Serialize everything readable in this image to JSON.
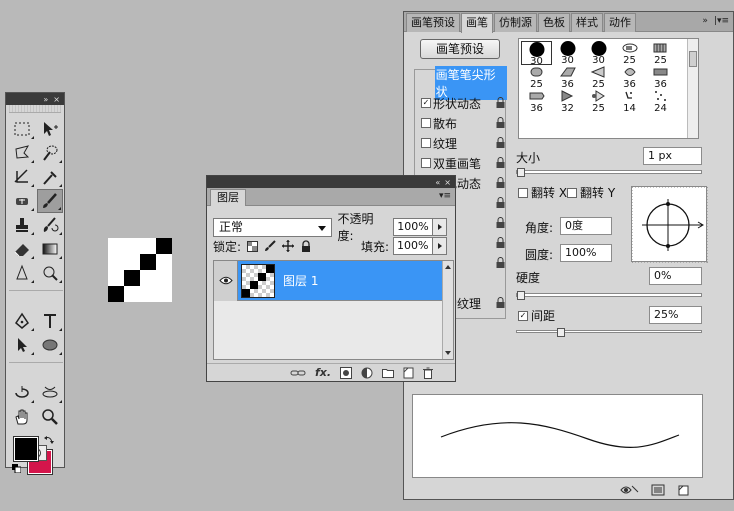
{
  "tools_panel": {
    "collapse_glyph": "»",
    "close_glyph": "×",
    "tools": [
      {
        "name": "marquee-tool-icon",
        "selected": false
      },
      {
        "name": "move-tool-icon",
        "selected": false
      },
      {
        "name": "lasso-tool-icon",
        "selected": false
      },
      {
        "name": "quick-selection-tool-icon",
        "selected": false
      },
      {
        "name": "crop-tool-icon",
        "selected": false
      },
      {
        "name": "eyedropper-tool-icon",
        "selected": false
      },
      {
        "name": "healing-brush-tool-icon",
        "selected": false
      },
      {
        "name": "brush-tool-icon",
        "selected": true
      },
      {
        "name": "clone-stamp-tool-icon",
        "selected": false
      },
      {
        "name": "history-brush-tool-icon",
        "selected": false
      },
      {
        "name": "eraser-tool-icon",
        "selected": false
      },
      {
        "name": "gradient-tool-icon",
        "selected": false
      },
      {
        "name": "blur-tool-icon",
        "selected": false
      },
      {
        "name": "dodge-tool-icon",
        "selected": false
      },
      {
        "name": "pen-tool-icon",
        "selected": false
      },
      {
        "name": "type-tool-icon",
        "selected": false
      },
      {
        "name": "path-selection-tool-icon",
        "selected": false
      },
      {
        "name": "ellipse-tool-icon",
        "selected": false
      },
      {
        "name": "3d-rotate-tool-icon",
        "selected": false
      },
      {
        "name": "3d-orbit-tool-icon",
        "selected": false
      },
      {
        "name": "hand-tool-icon",
        "selected": false
      },
      {
        "name": "zoom-tool-icon",
        "selected": false
      }
    ],
    "foreground_color": "#000000",
    "background_color": "#d4154b"
  },
  "layers_panel": {
    "tab": "图层",
    "blend_mode": "正常",
    "opacity_label": "不透明度:",
    "opacity_value": "100%",
    "lock_label": "锁定:",
    "fill_label": "填充:",
    "fill_value": "100%",
    "layers": [
      {
        "name": "图层 1",
        "visible": true,
        "selected": true
      }
    ],
    "footer_icons": [
      "link-layers-icon",
      "fx-icon",
      "add-mask-icon",
      "adjustment-layer-icon",
      "new-group-icon",
      "new-layer-icon",
      "delete-layer-icon"
    ],
    "fx_label": "fx."
  },
  "brushes_panel": {
    "tabs": [
      "画笔预设",
      "画笔",
      "仿制源",
      "色板",
      "样式",
      "动作"
    ],
    "active_tab": 1,
    "preset_button": "画笔预设",
    "options": [
      {
        "label": "画笔笔尖形状",
        "checkbox": false,
        "checked": false,
        "highlight": true
      },
      {
        "label": "形状动态",
        "checkbox": true,
        "checked": true
      },
      {
        "label": "散布",
        "checkbox": true,
        "checked": false
      },
      {
        "label": "纹理",
        "checkbox": true,
        "checked": false
      },
      {
        "label": "双重画笔",
        "checkbox": true,
        "checked": false
      },
      {
        "label": "颜色动态",
        "checkbox": true,
        "checked": false
      },
      {
        "label": "",
        "checkbox": true,
        "checked": false
      },
      {
        "label": "",
        "checkbox": true,
        "checked": false
      },
      {
        "label": "",
        "checkbox": true,
        "checked": false
      },
      {
        "label": "",
        "checkbox": true,
        "checked": false
      },
      {
        "label": "保护纹理",
        "checkbox": true,
        "checked": false
      }
    ],
    "brush_tips": [
      {
        "size": "30",
        "shape": "hard-round"
      },
      {
        "size": "30",
        "shape": "hard-round"
      },
      {
        "size": "30",
        "shape": "hard-round"
      },
      {
        "size": "25",
        "shape": "airbrush"
      },
      {
        "size": "25",
        "shape": "flat-bristle"
      },
      {
        "size": "25",
        "shape": "round-bristle"
      },
      {
        "size": "36",
        "shape": "angled-bristle"
      },
      {
        "size": "25",
        "shape": "fan-bristle"
      },
      {
        "size": "36",
        "shape": "round-fan"
      },
      {
        "size": "36",
        "shape": "blunt-bristle"
      },
      {
        "size": "36",
        "shape": "point-bristle"
      },
      {
        "size": "32",
        "shape": "flat-point"
      },
      {
        "size": "25",
        "shape": "wet-edge"
      },
      {
        "size": "14",
        "shape": "spatter"
      },
      {
        "size": "24",
        "shape": "scatter"
      }
    ],
    "size_label": "大小",
    "size_value": "1 px",
    "flip_x_label": "翻转 X",
    "flip_y_label": "翻转 Y",
    "angle_label": "角度:",
    "angle_value": "0度",
    "roundness_label": "圆度:",
    "roundness_value": "100%",
    "hardness_label": "硬度",
    "hardness_value": "0%",
    "hardness_level": 0,
    "spacing_label": "间距",
    "spacing_checked": true,
    "spacing_value": "25%",
    "spacing_level": 0.25,
    "size_level": 0
  },
  "colors": {
    "selection_blue": "#3a95f5",
    "panel_gray": "#d6d6d6",
    "workspace_gray": "#b9b9b9"
  }
}
